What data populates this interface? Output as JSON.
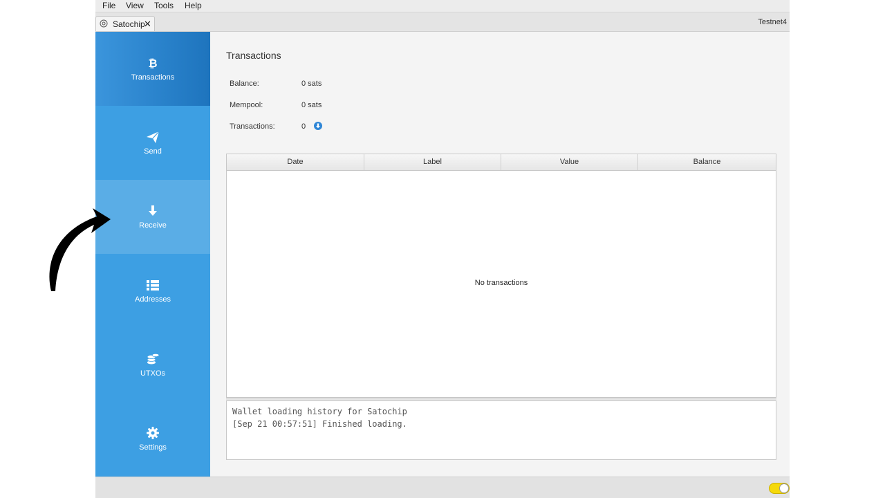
{
  "menu": [
    "File",
    "View",
    "Tools",
    "Help"
  ],
  "tab": {
    "label": "Satochip",
    "close": "✕",
    "icon": "wallet-icon"
  },
  "network_label": "Testnet4",
  "sidebar": {
    "items": [
      {
        "label": "Transactions",
        "icon": "bitcoin-icon",
        "active": true
      },
      {
        "label": "Send",
        "icon": "paper-plane-icon"
      },
      {
        "label": "Receive",
        "icon": "arrow-down-icon"
      },
      {
        "label": "Addresses",
        "icon": "list-icon"
      },
      {
        "label": "UTXOs",
        "icon": "coins-icon"
      },
      {
        "label": "Settings",
        "icon": "gear-icon"
      }
    ]
  },
  "main": {
    "title": "Transactions",
    "stats": [
      {
        "label": "Balance:",
        "value": "0 sats"
      },
      {
        "label": "Mempool:",
        "value": "0 sats"
      },
      {
        "label": "Transactions:",
        "value": "0"
      }
    ],
    "table": {
      "columns": [
        "Date",
        "Label",
        "Value",
        "Balance"
      ],
      "empty_text": "No transactions"
    },
    "log": [
      "Wallet loading history for Satochip",
      "[Sep 21 00:57:51] Finished loading."
    ]
  },
  "colors": {
    "sidebar": "#3d9fe3",
    "sidebar_active": "#1e74bd",
    "accent": "#2f86d6",
    "toggle": "#f5d90a"
  }
}
